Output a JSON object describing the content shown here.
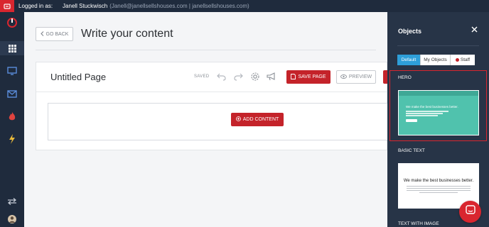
{
  "topbar": {
    "logged_in_label": "Logged in as:",
    "user_name": "Janell Stuckwisch",
    "user_details": "(Janell@janellsellshouses.com | janellsellshouses.com)"
  },
  "sidebar": {
    "items": [
      {
        "icon": "power-logo-icon"
      },
      {
        "icon": "apps-grid-icon"
      },
      {
        "icon": "monitor-icon"
      },
      {
        "icon": "mail-icon"
      },
      {
        "icon": "flame-icon"
      },
      {
        "icon": "lightning-icon"
      },
      {
        "icon": "swap-arrows-icon"
      },
      {
        "icon": "user-avatar-icon"
      }
    ]
  },
  "header": {
    "go_back_label": "GO BACK",
    "title": "Write your content"
  },
  "editor": {
    "page_name": "Untitled Page",
    "status": "SAVED",
    "save_label": "SAVE PAGE",
    "preview_label": "PREVIEW",
    "add_content_label": "ADD CONTENT"
  },
  "objects_panel": {
    "title": "Objects",
    "tabs": [
      {
        "label": "Default",
        "active": true
      },
      {
        "label": "My Objects",
        "active": false
      },
      {
        "label": "Staff",
        "active": false
      }
    ],
    "sections": [
      {
        "label": "HERO",
        "thumb_text": "We make the best businesses better."
      },
      {
        "label": "BASIC TEXT",
        "thumb_text": "We make the best businesses better."
      },
      {
        "label": "TEXT WITH IMAGE"
      }
    ]
  },
  "colors": {
    "accent_red": "#c4232a",
    "nav_dark": "#1f2b3d",
    "tab_blue": "#2e9fd9",
    "hero_teal": "#50c2ad"
  }
}
